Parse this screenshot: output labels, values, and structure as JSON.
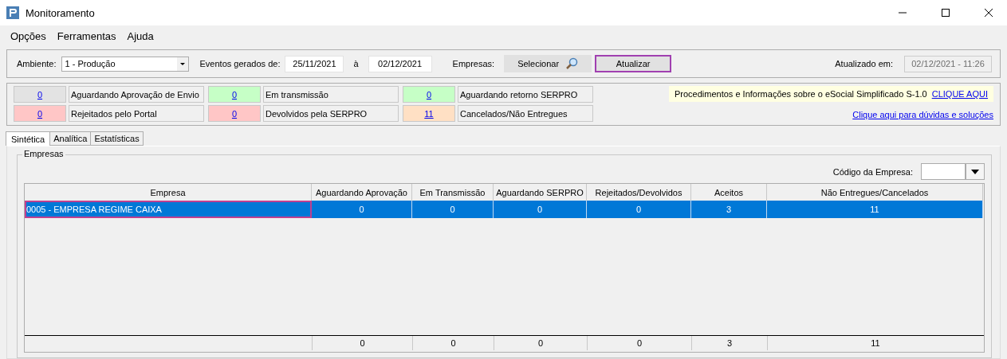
{
  "window": {
    "title": "Monitoramento"
  },
  "menu": [
    "Opções",
    "Ferramentas",
    "Ajuda"
  ],
  "filters": {
    "ambiente_label": "Ambiente:",
    "ambiente_value": "1 - Produção",
    "eventos_label": "Eventos gerados de:",
    "date_from": "25/11/2021",
    "date_sep": "à",
    "date_to": "02/12/2021",
    "empresas_label": "Empresas:",
    "select_button": "Selecionar",
    "refresh_button": "Atualizar",
    "updated_label": "Atualizado em:",
    "updated_value": "02/12/2021 - 11:26"
  },
  "status": [
    {
      "count": "0",
      "label": "Aguardando Aprovação de Envio",
      "color": "#e3e3e3"
    },
    {
      "count": "0",
      "label": "Em transmissão",
      "color": "#c6ffc6"
    },
    {
      "count": "0",
      "label": "Aguardando retorno SERPRO",
      "color": "#c6ffc6"
    },
    {
      "count": "0",
      "label": "Rejeitados pelo Portal",
      "color": "#ffc6c6"
    },
    {
      "count": "0",
      "label": "Devolvidos pela SERPRO",
      "color": "#ffc6c6"
    },
    {
      "count": "11",
      "label": "Cancelados/Não Entregues",
      "color": "#ffe0c4"
    }
  ],
  "info": {
    "text": "Procedimentos e Informações sobre o eSocial Simplificado S-1.0",
    "link": "CLIQUE AQUI",
    "help_link": "Clique aqui para dúvidas e soluções"
  },
  "tabs": [
    {
      "label": "Sintética",
      "selected": true
    },
    {
      "label": "Analítica",
      "selected": false
    },
    {
      "label": "Estatísticas",
      "selected": false
    }
  ],
  "group": {
    "title": "Empresas",
    "code_label": "Código da Empresa:"
  },
  "table": {
    "columns": [
      "Empresa",
      "Aguardando Aprovação",
      "Em Transmissão",
      "Aguardando SERPRO",
      "Rejeitados/Devolvidos",
      "Aceitos",
      "Não Entregues/Cancelados"
    ],
    "rows": [
      {
        "cells": [
          "0005 - EMPRESA REGIME CAIXA",
          "0",
          "0",
          "0",
          "0",
          "3",
          "11"
        ],
        "selected": true
      }
    ],
    "totals": [
      "0",
      "0",
      "0",
      "0",
      "3",
      "11"
    ]
  }
}
